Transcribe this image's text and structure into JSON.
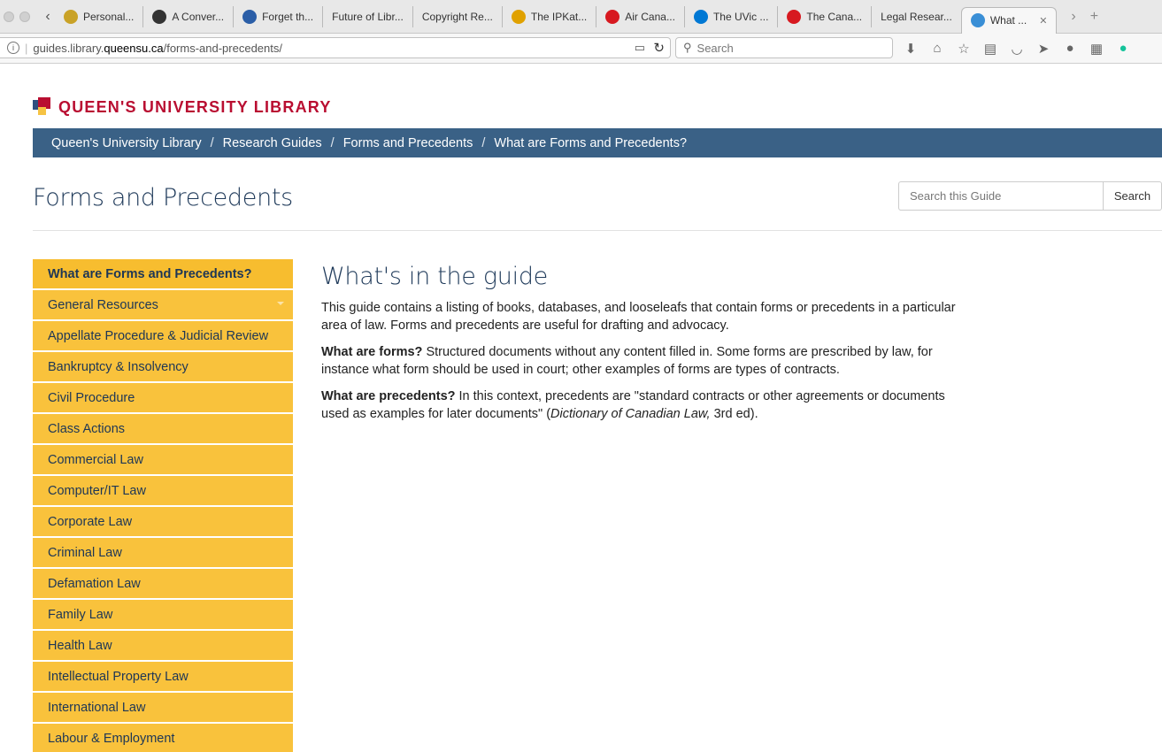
{
  "browser": {
    "tabs": [
      {
        "label": "Personal...",
        "icon": "leaf-favicon",
        "color": "#c9a227"
      },
      {
        "label": "A Conver...",
        "icon": "cc-favicon",
        "color": "#333333"
      },
      {
        "label": "Forget th...",
        "icon": "sb-favicon",
        "color": "#2b5ea7"
      },
      {
        "label": "Future of Libr...",
        "icon": "",
        "color": ""
      },
      {
        "label": "Copyright Re...",
        "icon": "",
        "color": ""
      },
      {
        "label": "The IPKat...",
        "icon": "cat-favicon",
        "color": "#e0a100"
      },
      {
        "label": "Air Cana...",
        "icon": "maple-circle-favicon",
        "color": "#d71920"
      },
      {
        "label": "The UVic ...",
        "icon": "sharepoint-favicon",
        "color": "#0078d4"
      },
      {
        "label": "The Cana...",
        "icon": "maple-favicon",
        "color": "#d71920"
      },
      {
        "label": "Legal Resear...",
        "icon": "",
        "color": ""
      },
      {
        "label": "What ...",
        "icon": "cloud-favicon",
        "color": "#3a8fd6",
        "active": true
      }
    ],
    "url_prefix": "guides.library.",
    "url_domain": "queensu.ca",
    "url_path": "/forms-and-precedents/",
    "search_placeholder": "Search"
  },
  "site": {
    "logo_text": "QUEEN'S UNIVERSITY LIBRARY",
    "colors": {
      "brand_red": "#b90e31",
      "breadcrumb_bar": "#3a6186",
      "nav_yellow": "#f9c23c",
      "heading_blue": "#1f3a5a"
    },
    "breadcrumb": [
      "Queen's University Library",
      "Research Guides",
      "Forms and Precedents",
      "What are Forms and Precedents?"
    ]
  },
  "guide": {
    "title": "Forms and Precedents",
    "search_placeholder": "Search this Guide",
    "search_button": "Search"
  },
  "sidebar": {
    "items": [
      {
        "label": "What are Forms and Precedents?",
        "active": true
      },
      {
        "label": "General Resources",
        "has_submenu": true
      },
      {
        "label": "Appellate Procedure & Judicial Review"
      },
      {
        "label": "Bankruptcy & Insolvency"
      },
      {
        "label": "Civil Procedure"
      },
      {
        "label": "Class Actions"
      },
      {
        "label": "Commercial Law"
      },
      {
        "label": "Computer/IT Law"
      },
      {
        "label": "Corporate Law"
      },
      {
        "label": "Criminal Law"
      },
      {
        "label": "Defamation Law"
      },
      {
        "label": "Family Law"
      },
      {
        "label": "Health Law"
      },
      {
        "label": "Intellectual Property Law"
      },
      {
        "label": "International Law"
      },
      {
        "label": "Labour & Employment"
      }
    ]
  },
  "main": {
    "heading": "What's in the guide",
    "intro": "This guide contains a listing of books, databases, and looseleafs that contain forms or precedents in a particular area of law.  Forms and precedents are useful for drafting and advocacy.",
    "forms_label": "What are forms?",
    "forms_text": " Structured documents without any content filled in.  Some forms are prescribed by law, for instance what form should be used in court; other examples of forms are types of contracts.",
    "precedents_label": "What are precedents?",
    "precedents_text": " In this context, precedents are \"standard contracts or other agreements or documents used as examples for later documents\" (",
    "precedents_source": "Dictionary of Canadian Law,",
    "precedents_tail": " 3rd ed)."
  }
}
